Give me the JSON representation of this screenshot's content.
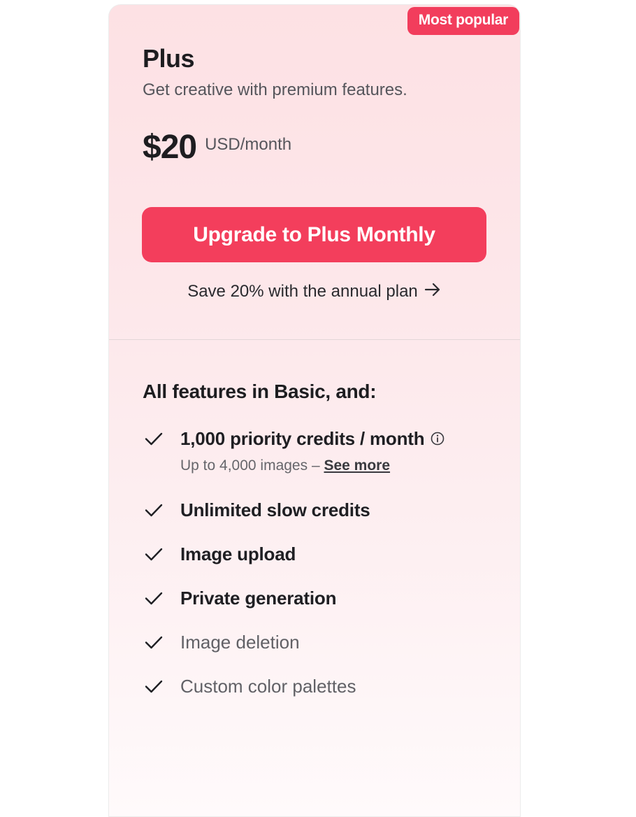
{
  "badge": "Most popular",
  "plan": {
    "name": "Plus",
    "subtitle": "Get creative with premium features.",
    "price": "$20",
    "price_unit": "USD/month"
  },
  "cta": {
    "label": "Upgrade to Plus Monthly"
  },
  "annual_link": {
    "label": "Save 20% with the annual plan",
    "icon": "arrow-right-icon"
  },
  "features": {
    "title": "All features in Basic, and:",
    "items": [
      {
        "label": "1,000 priority credits / month",
        "icon": "info-icon",
        "note": "Up to 4,000 images – ",
        "note_link": "See more"
      },
      {
        "label": "Unlimited slow credits"
      },
      {
        "label": "Image upload"
      },
      {
        "label": "Private generation"
      },
      {
        "label": "Image deletion"
      },
      {
        "label": "Custom color palettes"
      }
    ]
  },
  "colors": {
    "accent": "#f23d5c",
    "card_top": "#fde1e4",
    "text_primary": "#1d1d20",
    "text_secondary": "#55555b"
  }
}
